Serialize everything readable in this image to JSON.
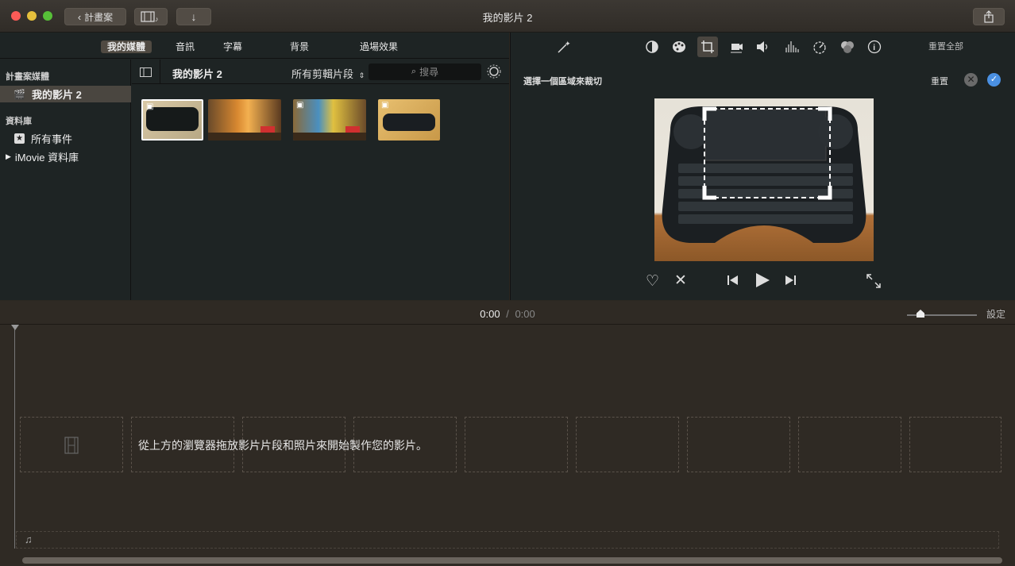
{
  "window": {
    "title": "我的影片 2",
    "back_button_label": "計畫案"
  },
  "browser": {
    "tabs": [
      "我的媒體",
      "音訊",
      "字幕",
      "背景",
      "過場效果"
    ],
    "project_title": "我的影片 2",
    "filter_label": "所有剪輯片段",
    "search_placeholder": "搜尋"
  },
  "sidebar": {
    "section_project": "計畫案媒體",
    "project_item": "我的影片 2",
    "section_library": "資料庫",
    "all_events": "所有事件",
    "library_item": "iMovie 資料庫"
  },
  "viewer": {
    "reset_all_label": "重置全部",
    "crop_instruction": "選擇一個區域來裁切",
    "reset_label": "重置",
    "tools": [
      "magic-wand-icon",
      "color-balance-icon",
      "color-correction-icon",
      "crop-icon",
      "stabilization-icon",
      "volume-icon",
      "noise-reduction-icon",
      "speed-icon",
      "clip-filter-icon",
      "info-icon"
    ]
  },
  "timeline": {
    "current_time": "0:00",
    "separator": "/",
    "total_time": "0:00",
    "settings_label": "設定",
    "empty_hint": "從上方的瀏覽器拖放影片片段和照片來開始製作您的影片。"
  },
  "colors": {
    "accent_blue": "#4a90e2",
    "close_red": "#fc5b57",
    "min_yellow": "#e5bf3c",
    "max_green": "#57c038"
  }
}
